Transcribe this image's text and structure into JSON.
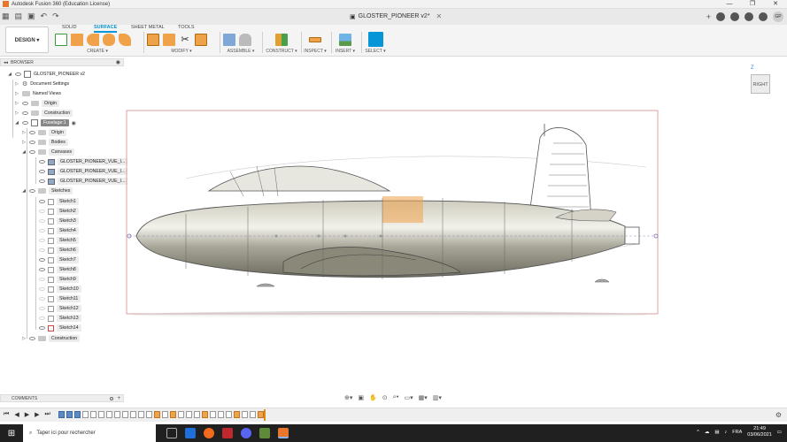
{
  "window": {
    "title": "Autodesk Fusion 360 (Education License)",
    "controls": [
      "—",
      "❐",
      "✕"
    ]
  },
  "doc_tab": {
    "title": "GLOSTER_PIONEER v2*"
  },
  "profile": {
    "initials": "GP"
  },
  "workspace_tabs": [
    "SOLID",
    "SURFACE",
    "SHEET METAL",
    "TOOLS"
  ],
  "active_workspace_tab": "SURFACE",
  "design_button": "DESIGN ▾",
  "toolbar_groups": [
    "CREATE ▾",
    "MODIFY ▾",
    "ASSEMBLE ▾",
    "CONSTRUCT ▾",
    "INSPECT ▾",
    "INSERT ▾",
    "SELECT ▾"
  ],
  "browser": {
    "header": "BROWSER",
    "root": "GLOSTER_PIONEER v2",
    "items": [
      "Document Settings",
      "Named Views",
      "Origin",
      "Construction",
      "Fuselage:1",
      "Origin",
      "Bodies",
      "Canvases",
      "GLOSTER_PIONEER_VUE_I...",
      "GLOSTER_PIONEER_VUE_I...",
      "GLOSTER_PIONEER_VUE_I...",
      "Sketches",
      "Sketch1",
      "Sketch2",
      "Sketch3",
      "Sketch4",
      "Sketch5",
      "Sketch6",
      "Sketch7",
      "Sketch8",
      "Sketch9",
      "Sketch10",
      "Sketch11",
      "Sketch12",
      "Sketch13",
      "Sketch14",
      "Construction"
    ]
  },
  "viewcube": {
    "face": "RIGHT",
    "axis": "Z"
  },
  "comments": {
    "label": "COMMENTS"
  },
  "navbar": {
    "icons": [
      "orbit-icon",
      "pan-icon",
      "zoom-icon",
      "fit-icon",
      "display-icon",
      "grid-icon",
      "viewports-icon"
    ]
  },
  "taskbar": {
    "search_placeholder": "Taper ici pour rechercher",
    "language": "FRA",
    "time": "21:49",
    "date": "03/06/2021"
  },
  "colors": {
    "accent": "#0696d7",
    "fuselage": "#9a9888",
    "canvas_frame": "#d88a8a",
    "highlight": "#f0a24a"
  }
}
